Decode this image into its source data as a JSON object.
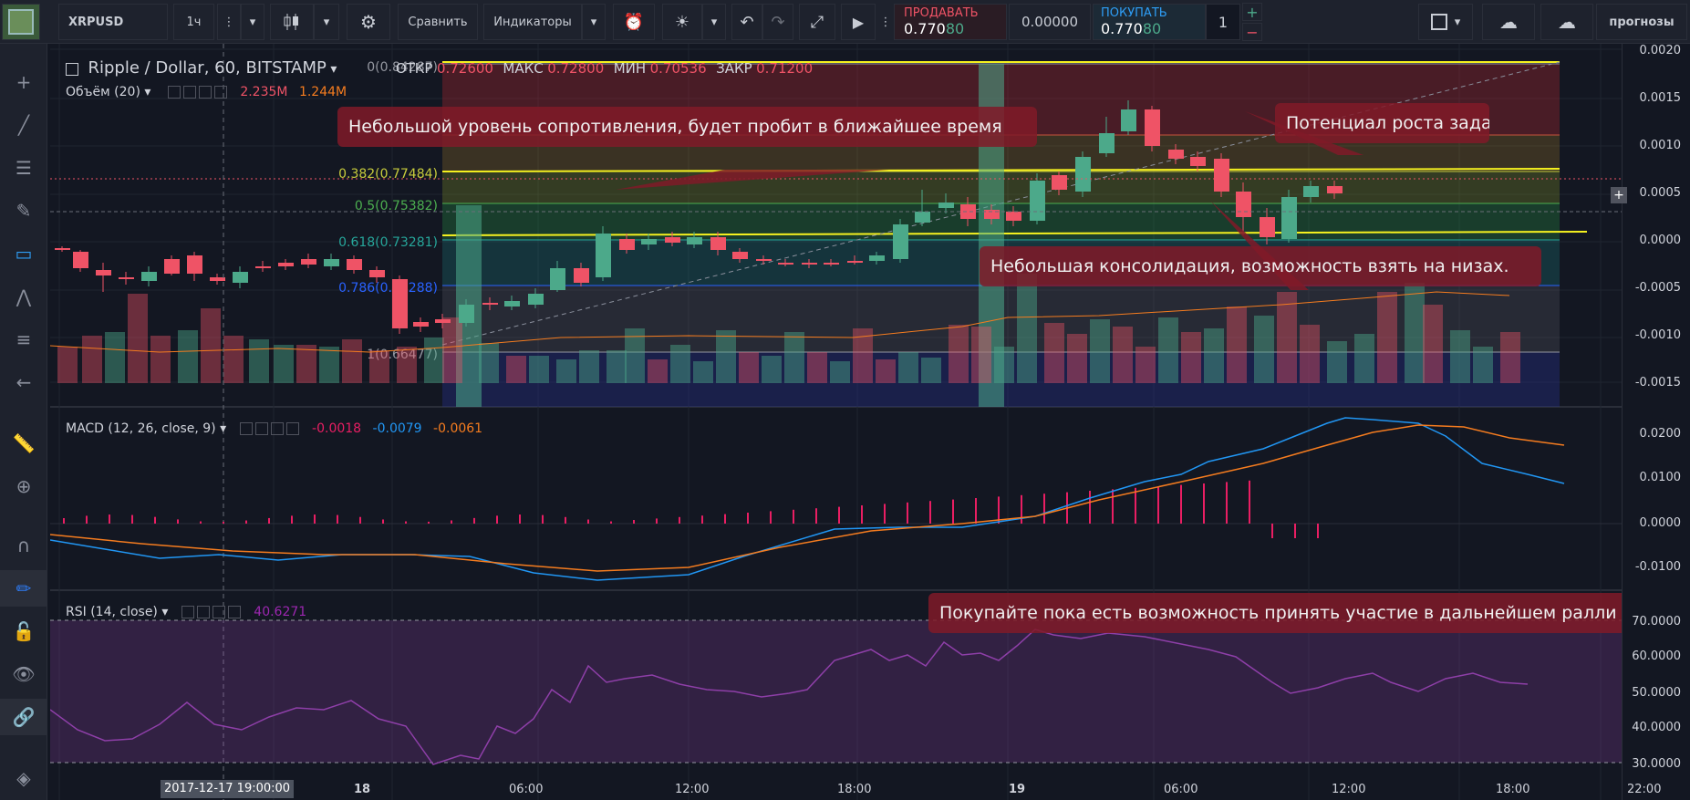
{
  "toolbar": {
    "symbol": "XRPUSD",
    "interval": "1ч",
    "compare_label": "Сравнить",
    "indicators_label": "Индикаторы",
    "sell_label": "ПРОДАВАТЬ",
    "sell_price_main": "0.770",
    "sell_price_tail": "80",
    "spread": "0.00000",
    "buy_label": "ПОКУПАТЬ",
    "buy_price_main": "0.770",
    "buy_price_tail": "80",
    "quantity": "1",
    "plus": "+",
    "minus": "−",
    "forecasts_label": "прогнозы"
  },
  "legend": {
    "title": "Ripple / Dollar, 60, BITSTAMP",
    "open_label": "ОТКР",
    "open_value": "0.72600",
    "high_label": "МАКС",
    "high_value": "0.72800",
    "low_label": "МИН",
    "low_value": "0.70536",
    "close_label": "ЗАКР",
    "close_value": "0.71200",
    "volume_label": "Объём (20)",
    "volume_value_1": "2.235M",
    "volume_value_2": "1.244M",
    "macd_label": "MACD (12, 26, close, 9)",
    "macd_hist": "-0.0018",
    "macd_line": "-0.0079",
    "macd_signal": "-0.0061",
    "rsi_label": "RSI (14, close)",
    "rsi_value": "40.6271"
  },
  "fib_levels": [
    {
      "label": "0(0.84287)",
      "color": "#9598a1"
    },
    {
      "label": "0.382(0.77484)",
      "color": "#c8cc3c"
    },
    {
      "label": "0.5(0.75382)",
      "color": "#4caf50"
    },
    {
      "label": "0.618(0.73281)",
      "color": "#26a69a"
    },
    {
      "label": "0.786(0.70288)",
      "color": "#2962ff"
    },
    {
      "label": "1(0.66477)",
      "color": "#9598a1"
    }
  ],
  "annotations": {
    "a1": "Небольшой уровень сопротивления, будет пробит в ближайшее время",
    "a2": "Потенциал роста задан",
    "a3": "Небольшая консолидация, возможность взять на низах.",
    "a4": "Покупайте пока есть возможность принять участие в дальнейшем ралли"
  },
  "price_axis": [
    "0.0020",
    "0.0015",
    "0.0010",
    "0.0005",
    "0.0000",
    "-0.0005",
    "-0.0010",
    "-0.0015"
  ],
  "macd_axis": [
    "0.0200",
    "0.0100",
    "0.0000",
    "-0.0100"
  ],
  "rsi_axis": [
    "70.0000",
    "60.0000",
    "50.0000",
    "40.0000",
    "30.0000"
  ],
  "time_axis": {
    "cursor": "2017-12-17 19:00:00",
    "labels": [
      "18",
      "06:00",
      "12:00",
      "18:00",
      "19",
      "06:00",
      "12:00",
      "18:00",
      "22:00"
    ]
  },
  "colors": {
    "up": "#4ca98a",
    "down": "#ef5366",
    "fib_yellow": "#f5f11f",
    "macd_line": "#2196f3",
    "signal_line": "#f57c1f",
    "rsi_line": "#8e3fa8"
  }
}
